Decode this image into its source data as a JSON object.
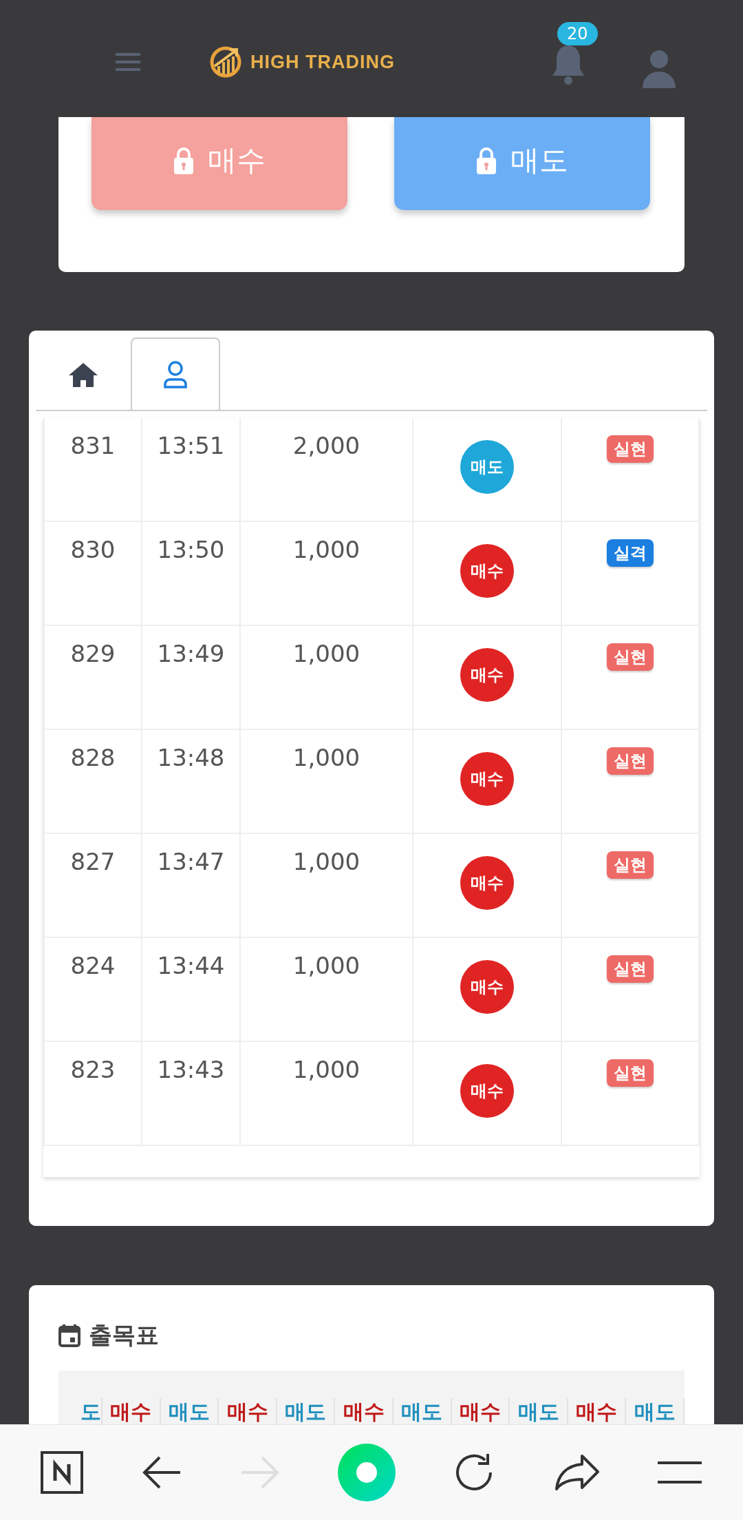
{
  "header": {
    "logo_text": "HIGH TRADING",
    "notification_count": "20"
  },
  "trade_buttons": [
    {
      "label": "매수",
      "kind": "buy"
    },
    {
      "label": "매도",
      "kind": "sell"
    }
  ],
  "tabs": [
    {
      "selected": false
    },
    {
      "selected": true
    }
  ],
  "history": [
    {
      "no": "831",
      "time": "13:51",
      "amount": "2,000",
      "side": "매도",
      "kind": "sell",
      "result": "실현",
      "color": "#ee6a66"
    },
    {
      "no": "830",
      "time": "13:50",
      "amount": "1,000",
      "side": "매수",
      "kind": "buy",
      "result": "실격",
      "color": "#1a7fe0"
    },
    {
      "no": "829",
      "time": "13:49",
      "amount": "1,000",
      "side": "매수",
      "kind": "buy",
      "result": "실현",
      "color": "#ee6a66"
    },
    {
      "no": "828",
      "time": "13:48",
      "amount": "1,000",
      "side": "매수",
      "kind": "buy",
      "result": "실현",
      "color": "#ee6a66"
    },
    {
      "no": "827",
      "time": "13:47",
      "amount": "1,000",
      "side": "매수",
      "kind": "buy",
      "result": "실현",
      "color": "#ee6a66"
    },
    {
      "no": "824",
      "time": "13:44",
      "amount": "1,000",
      "side": "매수",
      "kind": "buy",
      "result": "실현",
      "color": "#ee6a66"
    },
    {
      "no": "823",
      "time": "13:43",
      "amount": "1,000",
      "side": "매수",
      "kind": "buy",
      "result": "실현",
      "color": "#ee6a66"
    }
  ],
  "attendance": {
    "title": "출목표",
    "cells": [
      {
        "text": "도",
        "kind": "sell"
      },
      {
        "text": "매수",
        "kind": "buy"
      },
      {
        "text": "매도",
        "kind": "sell"
      },
      {
        "text": "매수",
        "kind": "buy"
      },
      {
        "text": "매도",
        "kind": "sell"
      },
      {
        "text": "매수",
        "kind": "buy"
      },
      {
        "text": "매도",
        "kind": "sell"
      },
      {
        "text": "매수",
        "kind": "buy"
      },
      {
        "text": "매도",
        "kind": "sell"
      },
      {
        "text": "매수",
        "kind": "buy"
      },
      {
        "text": "매도",
        "kind": "sell"
      }
    ]
  },
  "browser_nav": [
    {
      "kind": "home",
      "disabled": false
    },
    {
      "kind": "back",
      "disabled": false
    },
    {
      "kind": "forward",
      "disabled": true
    },
    {
      "kind": "app",
      "disabled": false
    },
    {
      "kind": "reload",
      "disabled": false
    },
    {
      "kind": "share",
      "disabled": false
    },
    {
      "kind": "menu",
      "disabled": false
    }
  ]
}
